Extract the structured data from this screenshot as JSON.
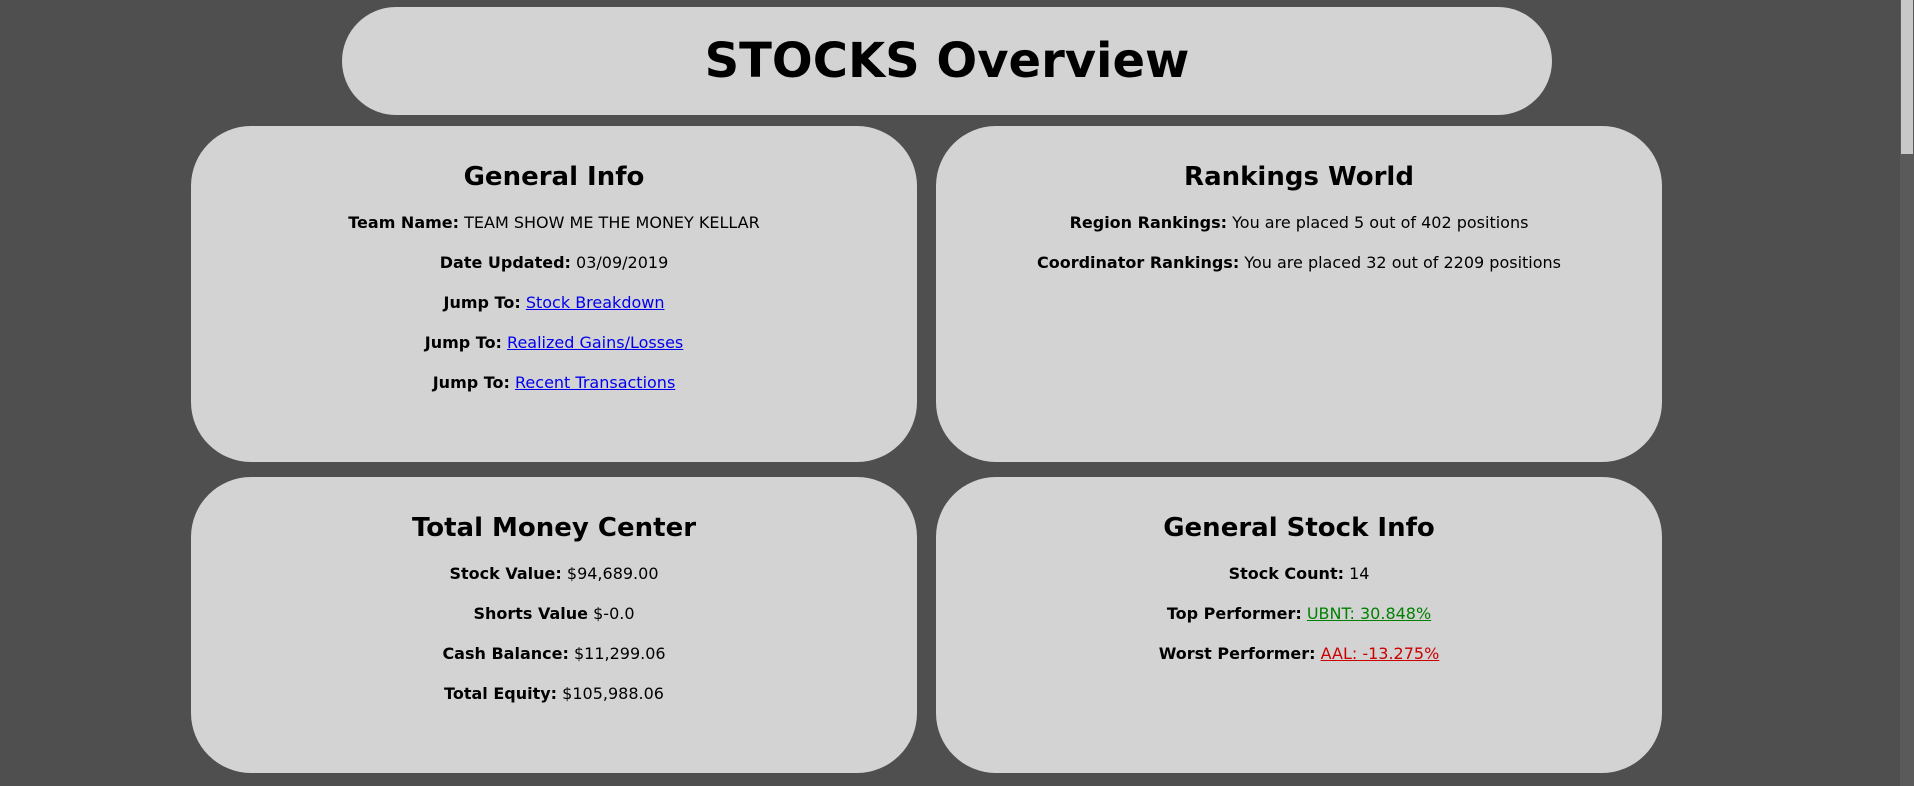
{
  "page_title": "STOCKS Overview",
  "general_info": {
    "heading": "General Info",
    "team_name_label": "Team Name:",
    "team_name": "TEAM SHOW ME THE MONEY KELLAR",
    "date_label": "Date Updated:",
    "date": "03/09/2019",
    "jumps": [
      {
        "label": "Jump To:",
        "link": "Stock Breakdown"
      },
      {
        "label": "Jump To:",
        "link": "Realized Gains/Losses"
      },
      {
        "label": "Jump To:",
        "link": "Recent Transactions"
      }
    ]
  },
  "rankings": {
    "heading": "Rankings World",
    "region_label": "Region Rankings:",
    "region_text": "You are placed 5 out of 402 positions",
    "coordinator_label": "Coordinator Rankings:",
    "coordinator_text": "You are placed 32 out of 2209 positions"
  },
  "money_center": {
    "heading": "Total Money Center",
    "stock_value_label": "Stock Value:",
    "stock_value": "$94,689.00",
    "shorts_value_label": "Shorts Value",
    "shorts_value": "$-0.0",
    "cash_balance_label": "Cash Balance:",
    "cash_balance": "$11,299.06",
    "total_equity_label": "Total Equity:",
    "total_equity": "$105,988.06"
  },
  "stock_info": {
    "heading": "General Stock Info",
    "count_label": "Stock Count:",
    "count": "14",
    "top_label": "Top Performer:",
    "top": "UBNT: 30.848%",
    "worst_label": "Worst Performer:",
    "worst": "AAL: -13.275%"
  },
  "colors": {
    "background": "#4f4f4f",
    "card": "#d3d3d3",
    "link": "#0000ee",
    "positive": "#008000",
    "negative": "#cc0000"
  }
}
